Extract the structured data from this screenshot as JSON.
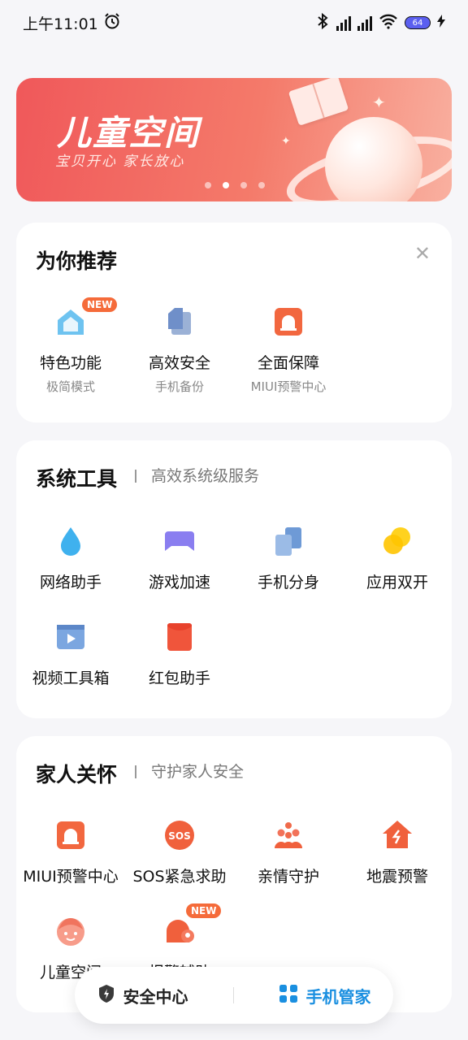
{
  "status": {
    "time": "上午11:01",
    "battery": "64"
  },
  "banner": {
    "title": "儿童空间",
    "subtitle": "宝贝开心  家长放心",
    "dots_count": 4,
    "active_dot": 1
  },
  "recommend": {
    "title": "为你推荐",
    "items": [
      {
        "label": "特色功能",
        "sub": "极简模式",
        "badge": "NEW",
        "icon": "home-icon"
      },
      {
        "label": "高效安全",
        "sub": "手机备份",
        "icon": "backup-icon"
      },
      {
        "label": "全面保障",
        "sub": "MIUI预警中心",
        "icon": "alarm-icon"
      }
    ]
  },
  "tools": {
    "title": "系统工具",
    "subtitle": "高效系统级服务",
    "items": [
      {
        "label": "网络助手",
        "icon": "water-drop-icon"
      },
      {
        "label": "游戏加速",
        "icon": "gamepad-icon"
      },
      {
        "label": "手机分身",
        "icon": "clone-icon"
      },
      {
        "label": "应用双开",
        "icon": "dual-app-icon"
      },
      {
        "label": "视频工具箱",
        "icon": "video-icon"
      },
      {
        "label": "红包助手",
        "icon": "red-envelope-icon"
      }
    ]
  },
  "family": {
    "title": "家人关怀",
    "subtitle": "守护家人安全",
    "items": [
      {
        "label": "MIUI预警中心",
        "icon": "alarm-icon"
      },
      {
        "label": "SOS紧急求助",
        "icon": "sos-icon"
      },
      {
        "label": "亲情守护",
        "icon": "family-icon"
      },
      {
        "label": "地震预警",
        "icon": "earthquake-icon"
      },
      {
        "label": "儿童空间",
        "icon": "child-face-icon"
      },
      {
        "label": "报警辅助",
        "badge": "NEW",
        "icon": "police-alarm-icon"
      }
    ]
  },
  "nav": {
    "security": "安全中心",
    "manager": "手机管家"
  },
  "colors": {
    "accent": "#1a8fe0",
    "banner": "#f0585a",
    "badge": "#f56b3a"
  }
}
